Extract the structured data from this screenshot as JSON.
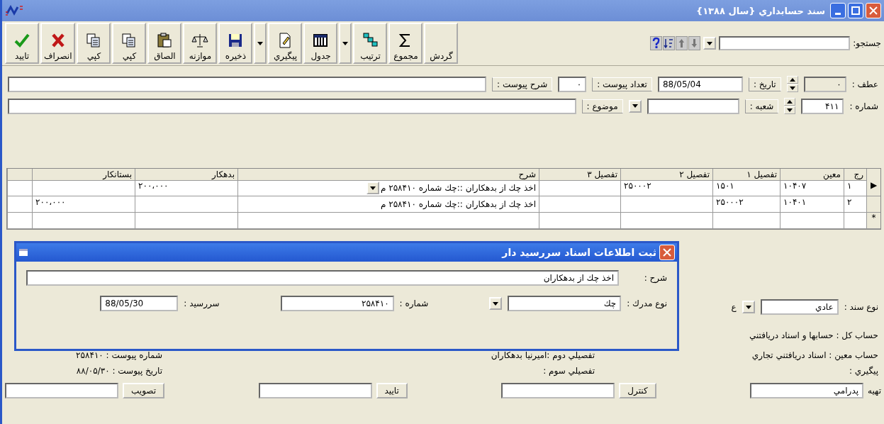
{
  "window": {
    "title": "سند حسابداري {سال ۱۳۸۸}"
  },
  "search": {
    "label": "جستجو:"
  },
  "toolbar": [
    {
      "label": "گردش",
      "kind": "none"
    },
    {
      "label": "مجموع",
      "kind": "sum"
    },
    {
      "label": "ترتيب",
      "kind": "sort"
    },
    {
      "kind": "arrow"
    },
    {
      "label": "جدول",
      "kind": "table"
    },
    {
      "label": "پيگيري",
      "kind": "track"
    },
    {
      "kind": "arrow"
    },
    {
      "label": "ذخيره",
      "kind": "save"
    },
    {
      "label": "موازنه",
      "kind": "scale"
    },
    {
      "label": "الصاق",
      "kind": "paste"
    },
    {
      "label": "کپي",
      "kind": "copy"
    },
    {
      "label": "کپي",
      "kind": "copy"
    },
    {
      "label": "انصراف",
      "kind": "cancel"
    },
    {
      "label": "تاييد",
      "kind": "ok"
    }
  ],
  "form": {
    "row_1": [
      {
        "label": "عطف :",
        "value": "۰",
        "kind": "spin",
        "disabled": true
      },
      {
        "label": "تاريخ :",
        "value": "88/05/04",
        "kind": "text",
        "disabled": false
      },
      {
        "label": "تعداد پيوست :",
        "value": "۰",
        "kind": "small",
        "disabled": false
      },
      {
        "label": "شرح پيوست :",
        "kind": "wide",
        "disabled": false
      }
    ],
    "row_2": [
      {
        "label": "شماره :",
        "value": "۴۱۱",
        "kind": "spin",
        "disabled": false
      },
      {
        "label": "شعبه :",
        "kind": "combo",
        "disabled": false
      },
      {
        "label": "موضوع :",
        "kind": "wide",
        "disabled": false
      }
    ]
  },
  "table": {
    "columns": [
      "رج",
      "معين",
      "تفصيل ۱",
      "تفصيل ۲",
      "تفصيل ۳",
      "شرح",
      "بدهکار",
      "بستانکار"
    ],
    "rows": [
      {
        "marker": "▶",
        "editing": true,
        "cells": [
          "۱",
          "۱۰۴۰۷",
          "۱۵۰۱",
          "۲۵۰۰۰۲",
          "",
          "اخذ چك از بدهكاران ::چك شماره ۲۵۸۴۱۰ م",
          "۲۰۰،۰۰۰",
          ""
        ]
      },
      {
        "editing": false,
        "cells": [
          "۲",
          "۱۰۴۰۱",
          "۲۵۰۰۰۲",
          "",
          "",
          "اخذ چك از بدهكاران ::چك شماره ۲۵۸۴۱۰ م",
          "",
          "۲۰۰،۰۰۰"
        ]
      },
      {
        "marker": "*",
        "editing": false,
        "cells": [
          "",
          "",
          "",
          "",
          "",
          "",
          "",
          ""
        ]
      }
    ]
  },
  "doc_type": {
    "label": "نوع سند :",
    "value": "عادي",
    "cut_label": "ع"
  },
  "info": {
    "account": "حساب کل : حسابها و اسناد دريافتني",
    "rows": [
      [
        "حساب معين : اسناد دريافتني تجاري",
        "تفصيلي دوم :اميرنيا بدهکاران",
        "شماره پيوست : ۲۵۸۴۱۰"
      ],
      [
        "پيگيري :",
        "تفصيلي سوم :",
        "تاريخ پيوست : ۸۸/۰۵/۳۰"
      ]
    ]
  },
  "footer": [
    {
      "label": "تهيه",
      "kind": "label",
      "value": "پدرامي"
    },
    {
      "label": "کنترل",
      "kind": "button"
    },
    {
      "label": "تاييد",
      "kind": "button"
    },
    {
      "label": "تصويب",
      "kind": "button"
    }
  ],
  "dialog": {
    "title": "ثبت اطلاعات اسناد سررسيد دار",
    "description_label": "شرح :",
    "description": "اخذ چك از بدهكاران",
    "fields": [
      {
        "label": "نوع مدرك :",
        "value": "چك",
        "kind": "combo"
      },
      {
        "label": "شماره :",
        "value": "۲۵۸۴۱۰",
        "kind": "text"
      },
      {
        "label": "سررسيد :",
        "value": "88/05/30",
        "kind": "date"
      }
    ]
  }
}
